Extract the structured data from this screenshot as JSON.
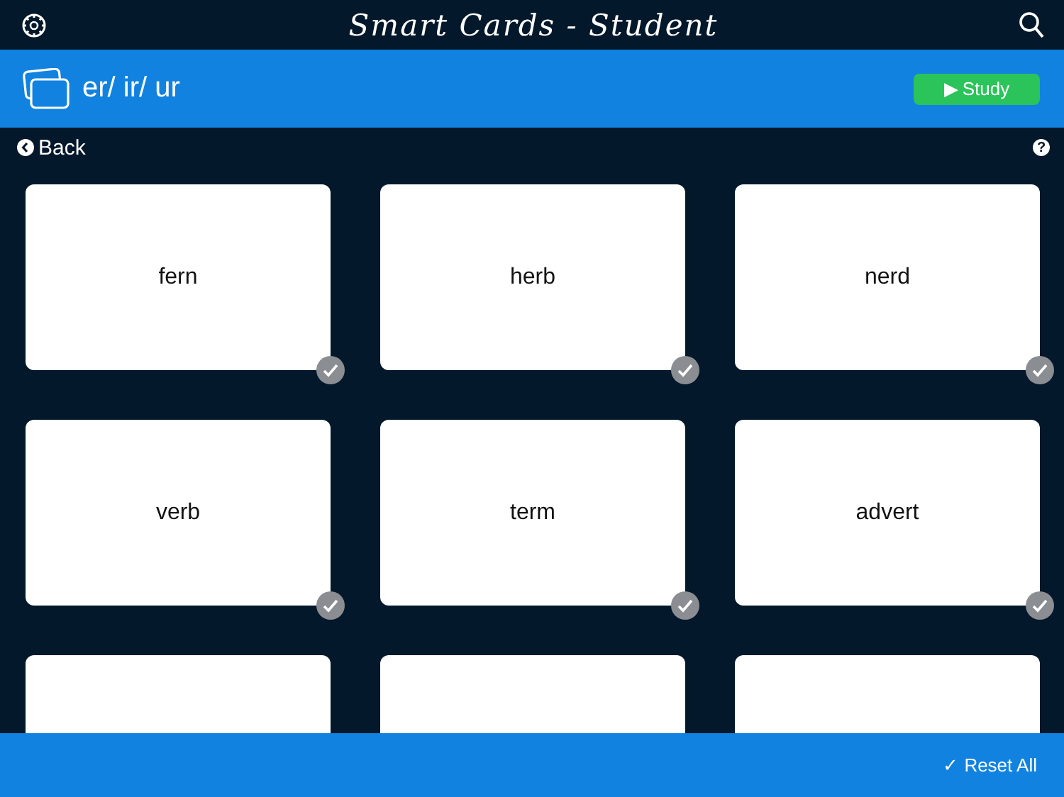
{
  "app_bar": {
    "title": "Smart Cards - Student"
  },
  "deck_bar": {
    "deck_title": "er/ ir/ ur",
    "study_button": {
      "icon": "▶",
      "label": "Study"
    }
  },
  "nav": {
    "back": "Back",
    "help": "?"
  },
  "cards": [
    {
      "word": "fern",
      "checked": false
    },
    {
      "word": "herb",
      "checked": false
    },
    {
      "word": "nerd",
      "checked": false
    },
    {
      "word": "verb",
      "checked": false
    },
    {
      "word": "term",
      "checked": false
    },
    {
      "word": "advert",
      "checked": false
    }
  ],
  "footer": {
    "reset_button": {
      "icon": "✓",
      "label": "Reset All"
    }
  }
}
